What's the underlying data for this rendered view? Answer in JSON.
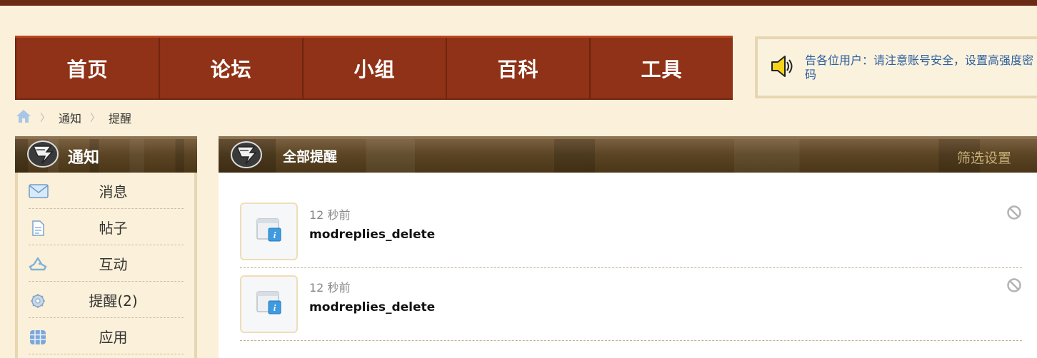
{
  "nav": {
    "items": [
      {
        "label": "首页"
      },
      {
        "label": "论坛"
      },
      {
        "label": "小组"
      },
      {
        "label": "百科"
      },
      {
        "label": "工具"
      }
    ]
  },
  "notice": {
    "text": "告各位用户：请注意账号安全，设置高强度密码",
    "icon": "speaker-icon"
  },
  "breadcrumb": {
    "home_icon": "home-icon",
    "items": [
      {
        "label": "通知"
      },
      {
        "label": "提醒"
      }
    ]
  },
  "sidebar": {
    "title": "通知",
    "items": [
      {
        "label": "消息",
        "icon": "envelope-icon"
      },
      {
        "label": "帖子",
        "icon": "document-icon"
      },
      {
        "label": "互动",
        "icon": "recycle-icon"
      },
      {
        "label": "提醒(2)",
        "icon": "gear-icon"
      },
      {
        "label": "应用",
        "icon": "grid-icon"
      }
    ]
  },
  "main": {
    "title": "全部提醒",
    "filter_label": "筛选设置",
    "notifications": [
      {
        "time": "12 秒前",
        "title": "modreplies_delete",
        "icon": "info-window-icon"
      },
      {
        "time": "12 秒前",
        "title": "modreplies_delete",
        "icon": "info-window-icon"
      }
    ]
  },
  "colors": {
    "page_bg": "#fbf0d9",
    "nav_bg": "#8f3217",
    "notice_text": "#2c5f9e",
    "filter_link": "#c7b07a"
  }
}
